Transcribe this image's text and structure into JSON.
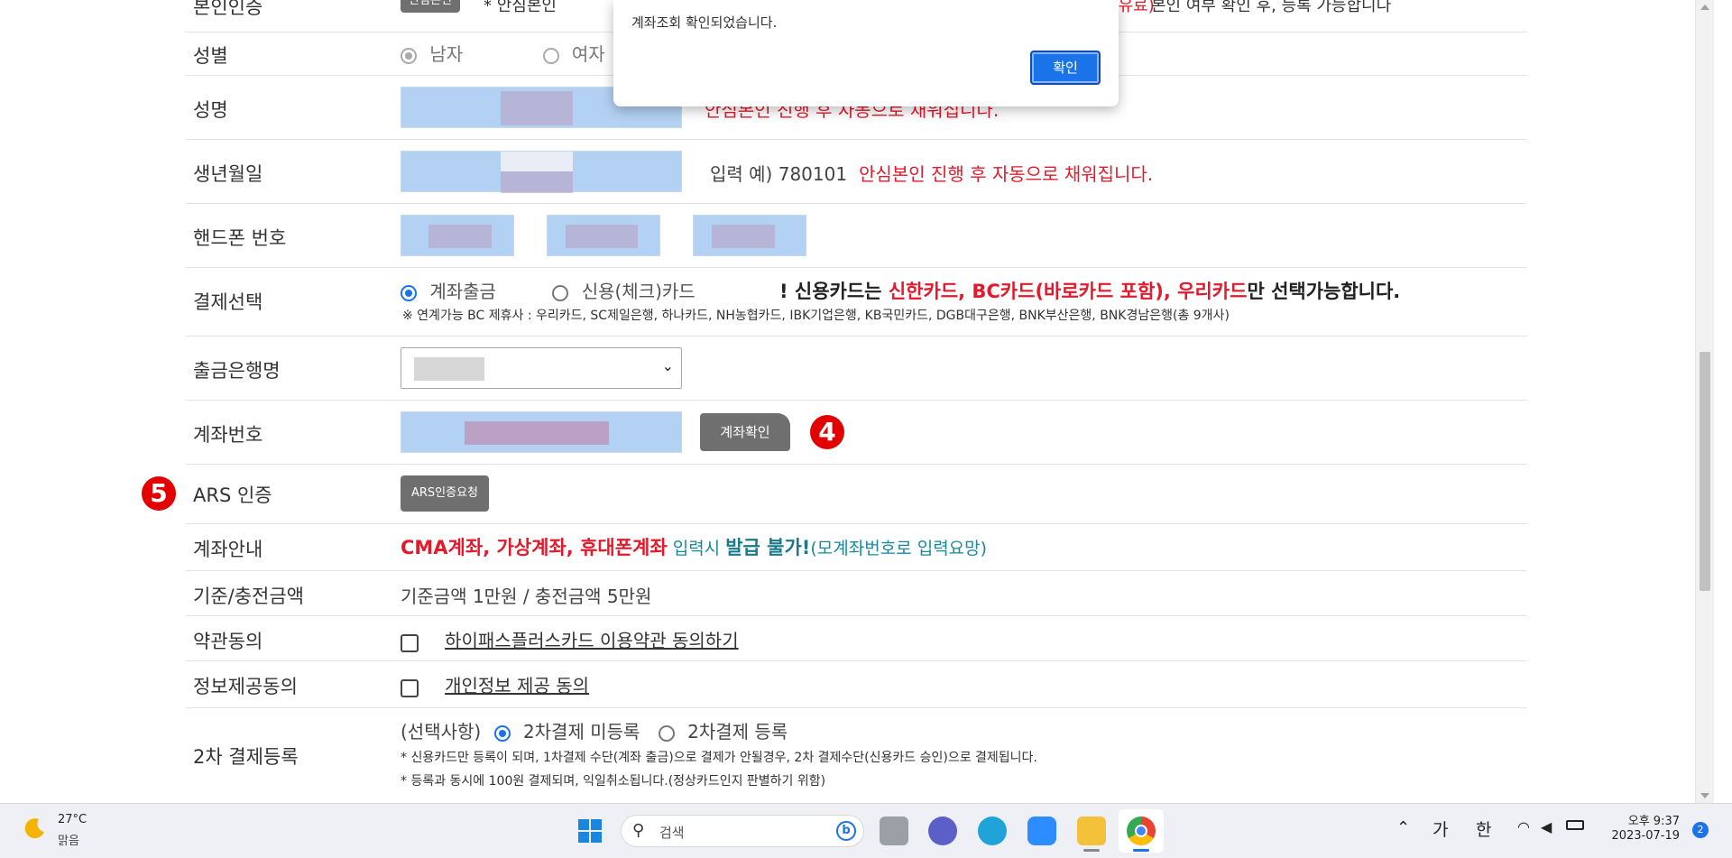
{
  "dialog": {
    "message": "계좌조회 확인되었습니다.",
    "ok_label": "확인"
  },
  "form": {
    "top_partial": {
      "button": "안심본인",
      "text_left": "* 안심본인",
      "text_mid": "스(유료)",
      "text_right": "본인 여부 확인 후, 등록 가능합니다"
    },
    "gender": {
      "label": "성별",
      "options": [
        "남자",
        "여자"
      ],
      "selected": "남자"
    },
    "name": {
      "label": "성명",
      "note": "안심본인 진행 후 자동으로 채워집니다."
    },
    "birth": {
      "label": "생년월일",
      "example": "입력 예) 780101",
      "note": "안심본인 진행 후 자동으로 채워집니다."
    },
    "phone": {
      "label": "핸드폰 번호"
    },
    "payment": {
      "label": "결제선택",
      "options": [
        "계좌출금",
        "신용(체크)카드"
      ],
      "selected": "계좌출금",
      "notice_prefix": "! 신용카드는 ",
      "notice_red": "신한카드, BC카드(바로카드 포함), 우리카드",
      "notice_suffix": "만 선택가능합니다.",
      "partners": "※ 연계가능 BC 제휴사 : 우리카드, SC제일은행, 하나카드, NH농협카드, IBK기업은행, KB국민카드, DGB대구은행, BNK부산은행, BNK경남은행(총 9개사)"
    },
    "bank": {
      "label": "출금은행명"
    },
    "account": {
      "label": "계좌번호",
      "check_button": "계좌확인",
      "step_badge": "4"
    },
    "ars": {
      "label": "ARS 인증",
      "button": "ARS인증요청",
      "step_badge": "5"
    },
    "account_guide": {
      "label": "계좌안내",
      "red": "CMA계좌, 가상계좌, 휴대폰계좌",
      "mid": " 입력시 ",
      "bold": "발급 불가!",
      "tail": "(모계좌번호로 입력요망)"
    },
    "amount": {
      "label": "기준/충전금액",
      "value": "기준금액 1만원 / 충전금액 5만원"
    },
    "terms": {
      "label": "약관동의",
      "link": "하이패스플러스카드 이용약관 동의하기"
    },
    "privacy": {
      "label": "정보제공동의",
      "link": "개인정보 제공 동의"
    },
    "second_payment": {
      "label": "2차 결제등록",
      "optional": "(선택사항)",
      "options": [
        "2차결제 미등록",
        "2차결제 등록"
      ],
      "selected": "2차결제 미등록",
      "note1": "* 신용카드만 등록이 되며, 1차결제 수단(계좌 출금)으로 결제가 안될경우, 2차 결제수단(신용카드 승인)으로 결제됩니다.",
      "note2": "* 등록과 동시에 100원 결제되며, 익일취소됩니다.(정상카드인지 판별하기 위함)"
    }
  },
  "taskbar": {
    "weather_temp": "27°C",
    "weather_desc": "맑음",
    "search_placeholder": "검색",
    "ime1": "가",
    "ime2": "한",
    "time": "오후 9:37",
    "date": "2023-07-19",
    "notif_count": "2"
  },
  "colors": {
    "accent": "#1a73e8",
    "red": "#e21a2c",
    "teal": "#1a8a9a"
  }
}
